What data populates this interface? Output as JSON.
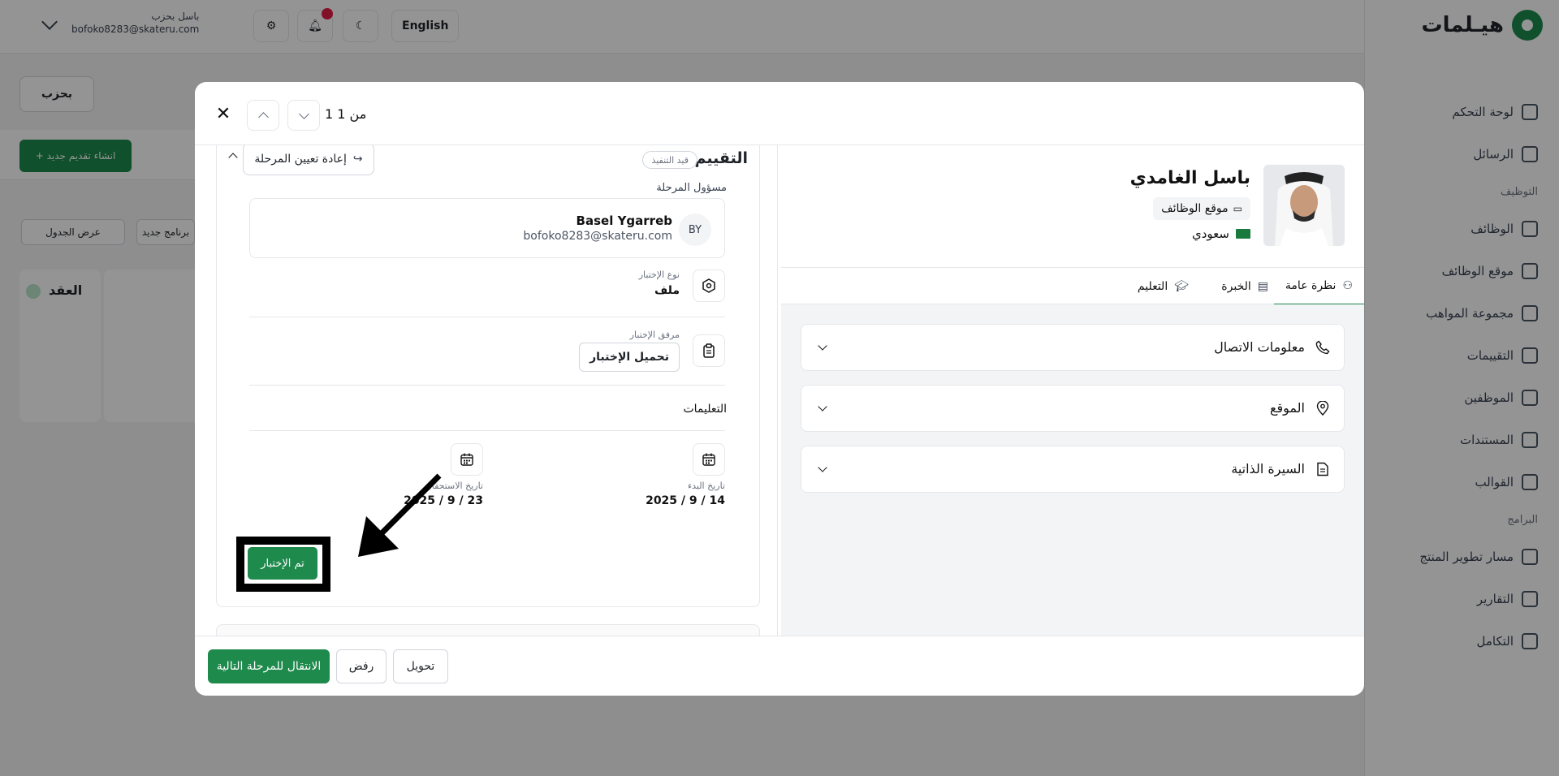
{
  "app": {
    "brand": "هيـلمات",
    "user_name": "باسل بحزب",
    "user_email": "bofoko8283@skateru.com",
    "language": "English",
    "nav": [
      {
        "label": "لوحة التحكم",
        "icon": "dashboard-icon"
      },
      {
        "label": "الرسائل",
        "icon": "mail-icon"
      },
      {
        "section": "التوظيف"
      },
      {
        "label": "الوظائف",
        "icon": "briefcase-icon"
      },
      {
        "label": "موقع الوظائف",
        "icon": "monitor-icon"
      },
      {
        "label": "مجموعة المواهب",
        "icon": "star-icon"
      },
      {
        "label": "التقييمات",
        "icon": "table-icon"
      },
      {
        "label": "الموظفين",
        "icon": "user-icon"
      },
      {
        "label": "المستندات",
        "icon": "file-icon"
      },
      {
        "label": "القوالب",
        "icon": "template-icon"
      },
      {
        "section": "البرامج"
      },
      {
        "label": "مسار تطوير المنتج",
        "icon": "flame-icon"
      },
      {
        "label": "التقارير",
        "icon": "chart-icon"
      },
      {
        "label": "التكامل",
        "icon": "link-icon"
      }
    ],
    "filter_btn": "بحزب",
    "create_btn": "+ انشاء تقديم جديد",
    "view_btn": "عرض الجدول",
    "view_btn2": "برنامج جديد",
    "column_title": "العقد"
  },
  "modal": {
    "pager": "1 من 1",
    "evaluation": {
      "title": "التقييم",
      "status": "قيد التنفيذ",
      "reassign_label": "إعادة تعيين المرحلة",
      "stage_owner_label": "مسؤول المرحلة",
      "owner_initials": "BY",
      "owner_name": "Basel Ygarreb",
      "owner_email": "bofoko8283@skateru.com",
      "test_type_label": "نوع الإختبار",
      "test_type_value": "ملف",
      "attachment_label": "مرفق الإختبار",
      "download_label": "تحميل الإختبار",
      "instructions_label": "التعليمات",
      "start_date_label": "تاريخ البدء",
      "start_date_value": "2025 / 9 / 14",
      "due_date_label": "تاريخ الاستحقاق",
      "due_date_value": "2025 / 9 / 23",
      "done_label": "تم الإختبار"
    },
    "candidate": {
      "name": "باسل الغامدي",
      "source": "موقع الوظائف",
      "nationality": "سعودي",
      "tabs": [
        "نظرة عامة",
        "الخبرة",
        "التعليم"
      ],
      "sections": [
        "معلومات الاتصال",
        "الموقع",
        "السيرة الذاتية"
      ]
    },
    "footer": {
      "next_stage": "الانتقال للمرحلة التالية",
      "reject": "رفض",
      "transfer": "تحويل"
    }
  }
}
